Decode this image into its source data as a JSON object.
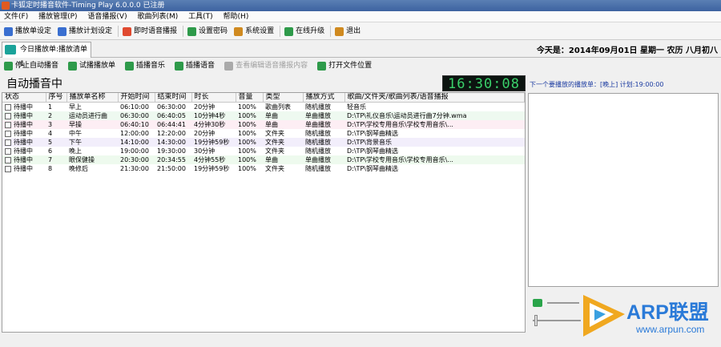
{
  "window": {
    "title": "卡狐定时播音软件-Timing Play 6.0.0.0 已注册"
  },
  "menu": [
    "文件(F)",
    "播放管理(P)",
    "语音播报(V)",
    "歌曲列表(M)",
    "工具(T)",
    "帮助(H)"
  ],
  "toolbar": {
    "items": [
      {
        "label": "播放单设定",
        "icon": "playlist-icon",
        "color": "#3a6fd0"
      },
      {
        "label": "播放计划设定",
        "icon": "plan-icon",
        "color": "#3a6fd0"
      },
      {
        "label": "即时语音播报",
        "icon": "broadcast-icon",
        "color": "#e04a30"
      },
      {
        "label": "设置密码",
        "icon": "gear-icon",
        "color": "#2e9a4a"
      },
      {
        "label": "系统设置",
        "icon": "settings-icon",
        "color": "#d08a20"
      },
      {
        "label": "在线升级",
        "icon": "refresh-icon",
        "color": "#2e9a4a"
      },
      {
        "label": "退出",
        "icon": "exit-icon",
        "color": "#d08a20"
      }
    ]
  },
  "tab": {
    "label": "今日播放单:播放清单1"
  },
  "date": {
    "text": "今天是：2014年09月01日 星期一 农历 八月初八"
  },
  "toolbar2": {
    "items": [
      {
        "label": "停止自动播音",
        "icon": "stop-icon",
        "color": "#2e9a4a",
        "enabled": true
      },
      {
        "label": "试播播放单",
        "icon": "play-icon",
        "color": "#2e9a4a",
        "enabled": true
      },
      {
        "label": "插播音乐",
        "icon": "music-icon",
        "color": "#2e9a4a",
        "enabled": true
      },
      {
        "label": "插播语音",
        "icon": "voice-icon",
        "color": "#2e9a4a",
        "enabled": true
      },
      {
        "label": "查看编辑语音播报内容",
        "icon": "edit-icon",
        "color": "#aaaaaa",
        "enabled": false
      },
      {
        "label": "打开文件位置",
        "icon": "folder-icon",
        "color": "#2e9a4a",
        "enabled": true
      }
    ]
  },
  "status": {
    "label": "自动播音中"
  },
  "clock": {
    "time": "16:30:08"
  },
  "table": {
    "columns": [
      "状态",
      "序号",
      "播放单名称",
      "开始时间",
      "结束时间",
      "时长",
      "音量",
      "类型",
      "播放方式",
      "歌曲/文件夹/歌曲列表/语音播报"
    ],
    "rows": [
      {
        "status": "待播中",
        "no": "1",
        "name": "早上",
        "start": "06:10:00",
        "end": "06:30:00",
        "dur": "20分钟",
        "vol": "100%",
        "type": "歌曲列表",
        "mode": "随机播放",
        "file": "轻音乐",
        "bg": "#ffffff"
      },
      {
        "status": "待播中",
        "no": "2",
        "name": "运动员进行曲",
        "start": "06:30:00",
        "end": "06:40:05",
        "dur": "10分钟4秒",
        "vol": "100%",
        "type": "单曲",
        "mode": "单曲播放",
        "file": "D:\\TP\\礼仪音乐\\运动员进行曲7分钟.wma",
        "bg": "#eef9f0"
      },
      {
        "status": "待播中",
        "no": "3",
        "name": "早操",
        "start": "06:40:10",
        "end": "06:44:41",
        "dur": "4分钟30秒",
        "vol": "100%",
        "type": "单曲",
        "mode": "单曲播放",
        "file": "D:\\TP\\学校专用音乐\\学校专用音乐\\...",
        "bg": "#fdeef4"
      },
      {
        "status": "待播中",
        "no": "4",
        "name": "中午",
        "start": "12:00:00",
        "end": "12:20:00",
        "dur": "20分钟",
        "vol": "100%",
        "type": "文件夹",
        "mode": "随机播放",
        "file": "D:\\TP\\钢琴曲精选",
        "bg": "#ffffff"
      },
      {
        "status": "待播中",
        "no": "5",
        "name": "下午",
        "start": "14:10:00",
        "end": "14:30:00",
        "dur": "19分钟59秒",
        "vol": "100%",
        "type": "文件夹",
        "mode": "随机播放",
        "file": "D:\\TP\\背景音乐",
        "bg": "#f2eefb"
      },
      {
        "status": "待播中",
        "no": "6",
        "name": "晚上",
        "start": "19:00:00",
        "end": "19:30:00",
        "dur": "30分钟",
        "vol": "100%",
        "type": "文件夹",
        "mode": "随机播放",
        "file": "D:\\TP\\钢琴曲精选",
        "bg": "#ffffff"
      },
      {
        "status": "待播中",
        "no": "7",
        "name": "眼保健操",
        "start": "20:30:00",
        "end": "20:34:55",
        "dur": "4分钟55秒",
        "vol": "100%",
        "type": "单曲",
        "mode": "单曲播放",
        "file": "D:\\TP\\学校专用音乐\\学校专用音乐\\...",
        "bg": "#eefaee"
      },
      {
        "status": "待播中",
        "no": "8",
        "name": "晚修后",
        "start": "21:30:00",
        "end": "21:50:00",
        "dur": "19分钟59秒",
        "vol": "100%",
        "type": "文件夹",
        "mode": "随机播放",
        "file": "D:\\TP\\钢琴曲精选",
        "bg": "#ffffff"
      }
    ]
  },
  "next": {
    "label": "下一个要播放的播放单：[晚上] 计划:19:00:00"
  },
  "watermark": {
    "brand": "ARP联盟",
    "url": "www.arpun.com"
  }
}
